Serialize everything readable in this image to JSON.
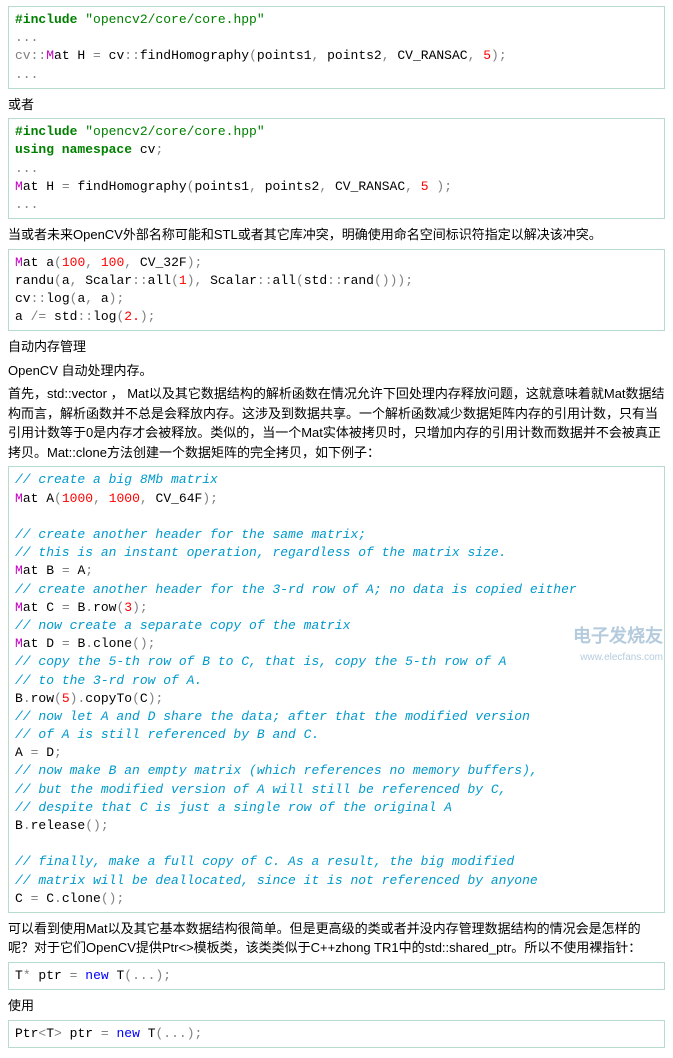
{
  "code1": {
    "l1a": "#include ",
    "l1b": "\"opencv2/core/core.hpp\"",
    "l2": "...",
    "l3a": "cv",
    "l3b": "::",
    "l3c": "M",
    "l3d": "at H ",
    "l3e": "=",
    "l3f": " cv",
    "l3g": "::",
    "l3h": "findHomography",
    "l3i": "(",
    "l3j": "points1",
    "l3k": ",",
    "l3l": " points2",
    "l3m": ",",
    "l3n": " CV_RANSAC",
    "l3o": ",",
    "l3p": " ",
    "l3q": "5",
    "l3r": ");",
    "l4": "..."
  },
  "t1": "或者",
  "code2": {
    "l1a": "#include ",
    "l1b": "\"opencv2/core/core.hpp\"",
    "l2a": "using namespace ",
    "l2b": "cv",
    "l2c": ";",
    "l3": "...",
    "l4a": "M",
    "l4b": "at H ",
    "l4c": "=",
    "l4d": " findHomography",
    "l4e": "(",
    "l4f": "points1",
    "l4g": ",",
    "l4h": " points2",
    "l4i": ",",
    "l4j": " CV_RANSAC",
    "l4k": ",",
    "l4l": " ",
    "l4m": "5",
    "l4n": " );",
    "l5": "..."
  },
  "t2": "当或者未来OpenCV外部名称可能和STL或者其它库冲突，明确使用命名空间标识符指定以解决该冲突。",
  "code3": {
    "l1a": "M",
    "l1b": "at a",
    "l1c": "(",
    "l1d": "100",
    "l1e": ",",
    "l1f": " ",
    "l1g": "100",
    "l1h": ",",
    "l1i": " CV_32F",
    "l1j": ");",
    "l2a": "randu",
    "l2b": "(",
    "l2c": "a",
    "l2d": ",",
    "l2e": " Scalar",
    "l2f": "::",
    "l2g": "all",
    "l2h": "(",
    "l2i": "1",
    "l2j": "),",
    "l2k": " Scalar",
    "l2l": "::",
    "l2m": "all",
    "l2n": "(",
    "l2o": "std",
    "l2p": "::",
    "l2q": "rand",
    "l2r": "()));",
    "l3a": "cv",
    "l3b": "::",
    "l3c": "log",
    "l3d": "(",
    "l3e": "a",
    "l3f": ",",
    "l3g": " a",
    "l3h": ");",
    "l4a": "a ",
    "l4b": "/=",
    "l4c": " std",
    "l4d": "::",
    "l4e": "log",
    "l4f": "(",
    "l4g": "2.",
    "l4h": ");"
  },
  "t3": "自动内存管理",
  "t4": "OpenCV 自动处理内存。",
  "t5": "首先，std::vector ， Mat以及其它数据结构的解析函数在情况允许下回处理内存释放问题，这就意味着就Mat数据结构而言，解析函数并不总是会释放内存。这涉及到数据共享。一个解析函数减少数据矩阵内存的引用计数，只有当引用计数等于0是内存才会被释放。类似的，当一个Mat实体被拷贝时，只增加内存的引用计数而数据并不会被真正拷贝。Mat::clone方法创建一个数据矩阵的完全拷贝，如下例子：",
  "code4": {
    "l1": "// create a big 8Mb matrix",
    "l2a": "M",
    "l2b": "at A",
    "l2c": "(",
    "l2d": "1000",
    "l2e": ",",
    "l2f": " ",
    "l2g": "1000",
    "l2h": ",",
    "l2i": " CV_64F",
    "l2j": ");",
    "l3": "",
    "l4": "// create another header for the same matrix;",
    "l5": "// this is an instant operation, regardless of the matrix size.",
    "l6a": "M",
    "l6b": "at B ",
    "l6c": "=",
    "l6d": " A",
    "l6e": ";",
    "l7": "// create another header for the 3-rd row of A; no data is copied either",
    "l8a": "M",
    "l8b": "at C ",
    "l8c": "=",
    "l8d": " B",
    "l8e": ".",
    "l8f": "row",
    "l8g": "(",
    "l8h": "3",
    "l8i": ");",
    "l9": "// now create a separate copy of the matrix",
    "l10a": "M",
    "l10b": "at D ",
    "l10c": "=",
    "l10d": " B",
    "l10e": ".",
    "l10f": "clone",
    "l10g": "();",
    "l11": "// copy the 5-th row of B to C, that is, copy the 5-th row of A",
    "l12": "// to the 3-rd row of A.",
    "l13a": "B",
    "l13b": ".",
    "l13c": "row",
    "l13d": "(",
    "l13e": "5",
    "l13f": ").",
    "l13g": "copyTo",
    "l13h": "(",
    "l13i": "C",
    "l13j": ");",
    "l14": "// now let A and D share the data; after that the modified version",
    "l15": "// of A is still referenced by B and C.",
    "l16a": "A ",
    "l16b": "=",
    "l16c": " D",
    "l16d": ";",
    "l17": "// now make B an empty matrix (which references no memory buffers),",
    "l18": "// but the modified version of A will still be referenced by C,",
    "l19": "// despite that C is just a single row of the original A",
    "l20a": "B",
    "l20b": ".",
    "l20c": "release",
    "l20d": "();",
    "l21": "",
    "l22": "// finally, make a full copy of C. As a result, the big modified",
    "l23": "// matrix will be deallocated, since it is not referenced by anyone",
    "l24a": "C ",
    "l24b": "=",
    "l24c": " C",
    "l24d": ".",
    "l24e": "clone",
    "l24f": "();"
  },
  "t6": "可以看到使用Mat以及其它基本数据结构很简单。但是更高级的类或者并没内存管理数据结构的情况会是怎样的呢？对于它们OpenCV提供Ptr<>模板类，该类类似于C++zhong TR1中的std::shared_ptr。所以不使用裸指针：",
  "code5": {
    "l1a": "T",
    "l1b": "*",
    "l1c": " ptr ",
    "l1d": "=",
    "l1e": " ",
    "l1f": "new",
    "l1g": " T",
    "l1h": "(...);"
  },
  "t7": "使用",
  "code6": {
    "l1a": "Ptr",
    "l1b": "<",
    "l1c": "T",
    "l1d": ">",
    "l1e": " ptr ",
    "l1f": "=",
    "l1g": " ",
    "l1h": "new",
    "l1i": " T",
    "l1j": "(...);"
  },
  "wm1": "电子发烧友",
  "wm2": "www.elecfans.com"
}
